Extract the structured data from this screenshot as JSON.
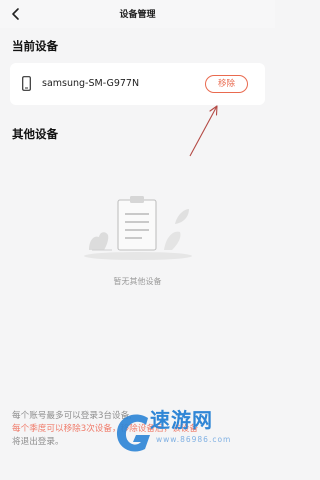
{
  "header": {
    "title": "设备管理"
  },
  "current": {
    "heading": "当前设备",
    "device_name": "samsung-SM-G977N",
    "remove_label": "移除"
  },
  "others": {
    "heading": "其他设备",
    "empty_text": "暂无其他设备"
  },
  "notes": {
    "line1": "每个账号最多可以登录3台设备,",
    "line2": "每个季度可以移除3次设备，移除设备后，该设备",
    "line3": "将退出登录。"
  },
  "watermark": {
    "brand": "速游网",
    "site": "www.86986.com"
  },
  "colors": {
    "accent": "#e96a4f",
    "note_red": "#f07b6a",
    "watermark_blue": "#2f86d6"
  }
}
